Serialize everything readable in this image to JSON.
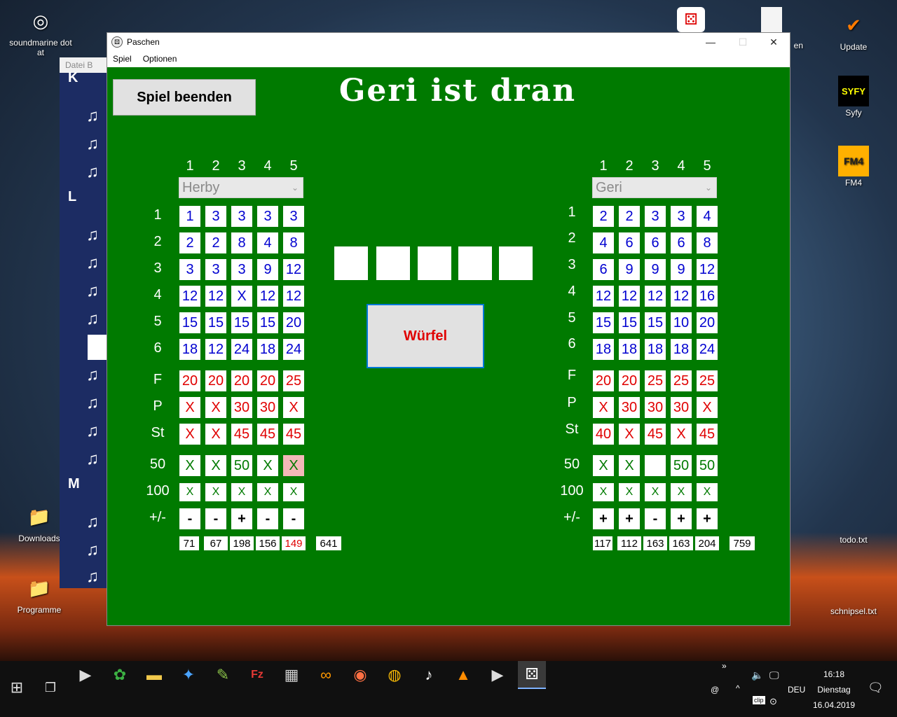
{
  "desktop": {
    "icons": [
      {
        "label": "soundmarine dot at",
        "glyph": "◎"
      },
      {
        "label": "Update",
        "glyph": "✔"
      },
      {
        "label": "Syfy",
        "glyph": "SYFY"
      },
      {
        "label": "FM4",
        "glyph": "FM4"
      },
      {
        "label": "Downloads",
        "glyph": "📁"
      },
      {
        "label": "Programme",
        "glyph": "📁"
      },
      {
        "label": "todo.txt",
        "glyph": ""
      },
      {
        "label": "schnipsel.txt",
        "glyph": ""
      },
      {
        "label": "en",
        "glyph": ""
      }
    ]
  },
  "bg_window": {
    "title": "Datei B",
    "letters": [
      "K",
      "L",
      "M"
    ]
  },
  "window": {
    "title": "Paschen",
    "menu": [
      "Spiel",
      "Optionen"
    ],
    "controls": {
      "minimize": "—",
      "maximize": "☐",
      "close": "✕"
    }
  },
  "game": {
    "end_button": "Spiel beenden",
    "turn_title": "Geri ist dran",
    "roll_button": "Würfel",
    "column_numbers": [
      "1",
      "2",
      "3",
      "4",
      "5"
    ],
    "row_labels": [
      "1",
      "2",
      "3",
      "4",
      "5",
      "6",
      "F",
      "P",
      "St",
      "50",
      "100",
      "+/-"
    ],
    "left_player": {
      "name": "Herby",
      "rows": [
        [
          [
            "1",
            "blue"
          ],
          [
            "3",
            "blue"
          ],
          [
            "3",
            "blue"
          ],
          [
            "3",
            "blue"
          ],
          [
            "3",
            "blue"
          ]
        ],
        [
          [
            "2",
            "blue"
          ],
          [
            "2",
            "blue"
          ],
          [
            "8",
            "blue"
          ],
          [
            "4",
            "blue"
          ],
          [
            "8",
            "blue"
          ]
        ],
        [
          [
            "3",
            "blue"
          ],
          [
            "3",
            "blue"
          ],
          [
            "3",
            "blue"
          ],
          [
            "9",
            "blue"
          ],
          [
            "12",
            "blue"
          ]
        ],
        [
          [
            "12",
            "blue"
          ],
          [
            "12",
            "blue"
          ],
          [
            "X",
            "blue"
          ],
          [
            "12",
            "blue"
          ],
          [
            "12",
            "blue"
          ]
        ],
        [
          [
            "15",
            "blue"
          ],
          [
            "15",
            "blue"
          ],
          [
            "15",
            "blue"
          ],
          [
            "15",
            "blue"
          ],
          [
            "20",
            "blue"
          ]
        ],
        [
          [
            "18",
            "blue"
          ],
          [
            "12",
            "blue"
          ],
          [
            "24",
            "blue"
          ],
          [
            "18",
            "blue"
          ],
          [
            "24",
            "blue"
          ]
        ],
        [
          [
            "20",
            "red"
          ],
          [
            "20",
            "red"
          ],
          [
            "20",
            "red"
          ],
          [
            "20",
            "red"
          ],
          [
            "25",
            "red"
          ]
        ],
        [
          [
            "X",
            "red"
          ],
          [
            "X",
            "red"
          ],
          [
            "30",
            "red"
          ],
          [
            "30",
            "red"
          ],
          [
            "X",
            "red"
          ]
        ],
        [
          [
            "X",
            "red"
          ],
          [
            "X",
            "red"
          ],
          [
            "45",
            "red"
          ],
          [
            "45",
            "red"
          ],
          [
            "45",
            "red"
          ]
        ],
        [
          [
            "X",
            "green"
          ],
          [
            "X",
            "green"
          ],
          [
            "50",
            "green"
          ],
          [
            "X",
            "green"
          ],
          [
            "X",
            "green-pink"
          ]
        ],
        [
          [
            "X",
            "green"
          ],
          [
            "X",
            "green"
          ],
          [
            "X",
            "green"
          ],
          [
            "X",
            "green"
          ],
          [
            "X",
            "green"
          ]
        ],
        [
          [
            "-",
            "black"
          ],
          [
            "-",
            "black"
          ],
          [
            "+",
            "black"
          ],
          [
            "-",
            "black"
          ],
          [
            "-",
            "black"
          ]
        ]
      ],
      "sums": [
        "71",
        "67",
        "198",
        "156",
        "149"
      ],
      "sum_colors": [
        "black",
        "black",
        "black",
        "black",
        "red"
      ],
      "total": "641"
    },
    "right_player": {
      "name": "Geri",
      "rows": [
        [
          [
            "2",
            "blue"
          ],
          [
            "2",
            "blue"
          ],
          [
            "3",
            "blue"
          ],
          [
            "3",
            "blue"
          ],
          [
            "4",
            "blue"
          ]
        ],
        [
          [
            "4",
            "blue"
          ],
          [
            "6",
            "blue"
          ],
          [
            "6",
            "blue"
          ],
          [
            "6",
            "blue"
          ],
          [
            "8",
            "blue"
          ]
        ],
        [
          [
            "6",
            "blue"
          ],
          [
            "9",
            "blue"
          ],
          [
            "9",
            "blue"
          ],
          [
            "9",
            "blue"
          ],
          [
            "12",
            "blue"
          ]
        ],
        [
          [
            "12",
            "blue"
          ],
          [
            "12",
            "blue"
          ],
          [
            "12",
            "blue"
          ],
          [
            "12",
            "blue"
          ],
          [
            "16",
            "blue"
          ]
        ],
        [
          [
            "15",
            "blue"
          ],
          [
            "15",
            "blue"
          ],
          [
            "15",
            "blue"
          ],
          [
            "10",
            "blue"
          ],
          [
            "20",
            "blue"
          ]
        ],
        [
          [
            "18",
            "blue"
          ],
          [
            "18",
            "blue"
          ],
          [
            "18",
            "blue"
          ],
          [
            "18",
            "blue"
          ],
          [
            "24",
            "blue"
          ]
        ],
        [
          [
            "20",
            "red"
          ],
          [
            "20",
            "red"
          ],
          [
            "25",
            "red"
          ],
          [
            "25",
            "red"
          ],
          [
            "25",
            "red"
          ]
        ],
        [
          [
            "X",
            "red"
          ],
          [
            "30",
            "red"
          ],
          [
            "30",
            "red"
          ],
          [
            "30",
            "red"
          ],
          [
            "X",
            "red"
          ]
        ],
        [
          [
            "40",
            "red"
          ],
          [
            "X",
            "red"
          ],
          [
            "45",
            "red"
          ],
          [
            "X",
            "red"
          ],
          [
            "45",
            "red"
          ]
        ],
        [
          [
            "X",
            "green"
          ],
          [
            "X",
            "green"
          ],
          [
            "",
            "green"
          ],
          [
            "50",
            "green"
          ],
          [
            "50",
            "green"
          ]
        ],
        [
          [
            "X",
            "green"
          ],
          [
            "X",
            "green"
          ],
          [
            "X",
            "green"
          ],
          [
            "X",
            "green"
          ],
          [
            "X",
            "green"
          ]
        ],
        [
          [
            "+",
            "black"
          ],
          [
            "+",
            "black"
          ],
          [
            "-",
            "black"
          ],
          [
            "+",
            "black"
          ],
          [
            "+",
            "black"
          ]
        ]
      ],
      "sums": [
        "117",
        "112",
        "163",
        "163",
        "204"
      ],
      "sum_colors": [
        "black",
        "black",
        "black",
        "black",
        "black"
      ],
      "total": "759"
    }
  },
  "taskbar": {
    "clock_time": "16:18",
    "clock_day": "Dienstag",
    "clock_date": "16.04.2019",
    "language": "DEU",
    "tray_at": "@",
    "tray_chevron": "^",
    "tray_overflow": "»",
    "tray_clip": "clip",
    "apps": [
      "media-player-icon",
      "cannabis-icon",
      "file-explorer-icon",
      "robot-icon",
      "notepad-icon",
      "filezilla-icon",
      "calculator-icon",
      "infinity-icon",
      "firefox-icon",
      "chrome-icon",
      "mp3-icon",
      "vlc-icon",
      "media-player-icon",
      "dice-game-icon"
    ]
  }
}
